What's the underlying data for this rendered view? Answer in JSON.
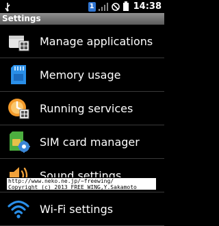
{
  "status_bar": {
    "notification_count": "1",
    "time": "14:38",
    "icons": [
      "usb-icon",
      "signal-icon",
      "no-sim-icon",
      "battery-icon"
    ]
  },
  "title_bar": {
    "title": "Settings"
  },
  "settings_list": [
    {
      "label": "Manage applications",
      "icon": "apps-icon"
    },
    {
      "label": "Memory usage",
      "icon": "memory-card-icon"
    },
    {
      "label": "Running services",
      "icon": "running-services-icon"
    },
    {
      "label": "SIM card manager",
      "icon": "sim-card-icon"
    },
    {
      "label": "Sound settings",
      "icon": "speaker-icon"
    },
    {
      "label": "Wi-Fi settings",
      "icon": "wifi-icon"
    }
  ],
  "overlay": {
    "line1": "http://www.neko.ne.jp/~freewing/",
    "line2": "Copyright (c) 2013 FREE WING,Y.Sakamoto"
  }
}
